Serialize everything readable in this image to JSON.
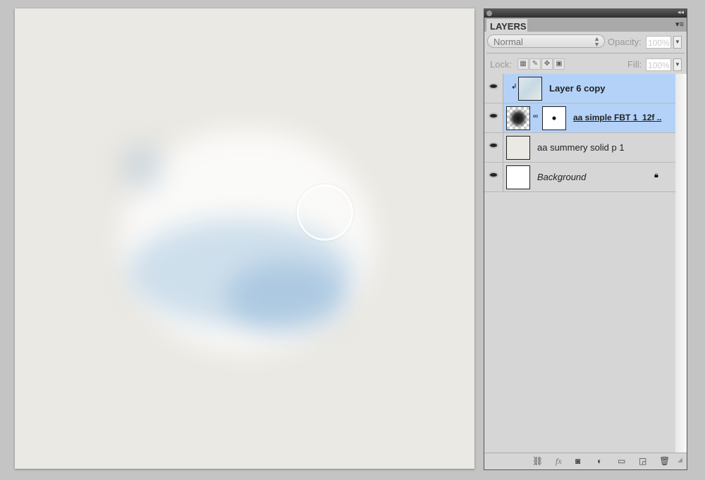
{
  "panel": {
    "tab": "LAYERS",
    "blend_mode": "Normal",
    "opacity_label": "Opacity:",
    "opacity_value": "100%",
    "lock_label": "Lock:",
    "fill_label": "Fill:",
    "fill_value": "100%",
    "lock_icons": [
      "lock-transparent-icon",
      "lock-image-icon",
      "lock-position-icon",
      "lock-all-icon"
    ],
    "layers": [
      {
        "name": "Layer 6 copy",
        "selected": true,
        "clipped": true
      },
      {
        "name": "aa simple FBT 1_12f ..",
        "selected": true,
        "has_mask": true
      },
      {
        "name": "aa summery solid p 1",
        "selected": false
      },
      {
        "name": "Background",
        "selected": false,
        "locked": true
      }
    ],
    "bottom_icons": [
      "link-icon",
      "fx-icon",
      "add-mask-icon",
      "adjustment-layer-icon",
      "new-group-icon",
      "new-layer-icon",
      "trash-icon"
    ],
    "selection_color": "#b4d2f8"
  }
}
